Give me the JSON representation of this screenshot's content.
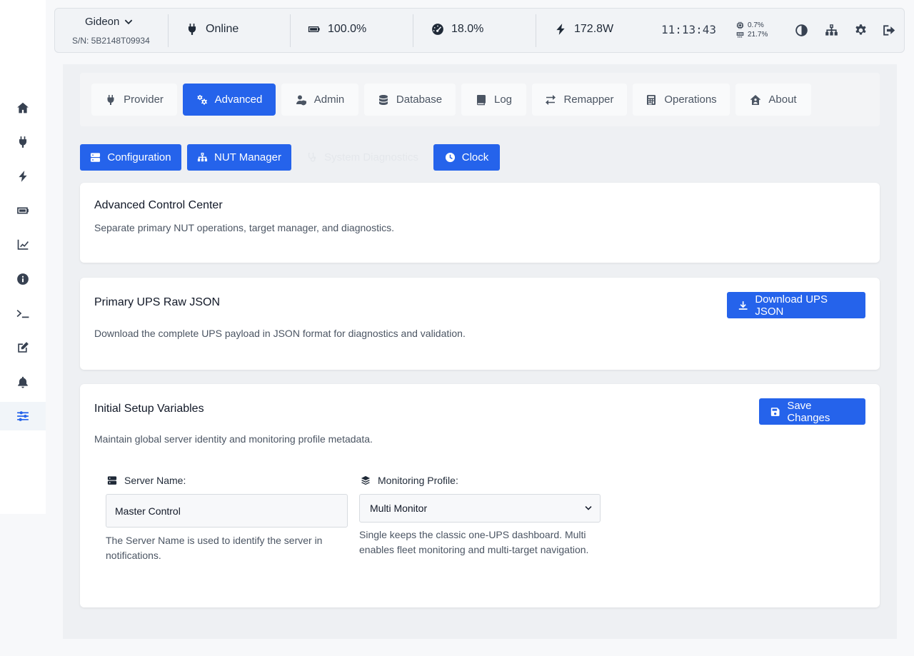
{
  "device": {
    "name": "Gideon",
    "serial": "S/N: 5B2148T09934"
  },
  "status": {
    "power": "Online",
    "battery": "100.0%",
    "load": "18.0%",
    "watts": "172.8W",
    "clock": "11:13:43",
    "cpu": "0.7%",
    "memory": "21.7%"
  },
  "sidebar": {
    "items": [
      {
        "icon": "home-icon"
      },
      {
        "icon": "plug-icon"
      },
      {
        "icon": "bolt-icon"
      },
      {
        "icon": "battery-icon"
      },
      {
        "icon": "chart-line-icon"
      },
      {
        "icon": "info-icon"
      },
      {
        "icon": "terminal-icon"
      },
      {
        "icon": "edit-icon"
      },
      {
        "icon": "bell-icon"
      },
      {
        "icon": "sliders-icon",
        "active": true
      }
    ]
  },
  "tabs": [
    {
      "label": "Provider"
    },
    {
      "label": "Advanced",
      "active": true
    },
    {
      "label": "Admin"
    },
    {
      "label": "Database"
    },
    {
      "label": "Log"
    },
    {
      "label": "Remapper"
    },
    {
      "label": "Operations"
    },
    {
      "label": "About"
    }
  ],
  "subtabs": [
    {
      "label": "Configuration"
    },
    {
      "label": "NUT Manager"
    },
    {
      "label": "System Diagnostics",
      "disabled": true
    },
    {
      "label": "Clock"
    }
  ],
  "cards": {
    "control": {
      "title": "Advanced Control Center",
      "desc": "Separate primary NUT operations, target manager, and diagnostics."
    },
    "raw_json": {
      "title": "Primary UPS Raw JSON",
      "desc": "Download the complete UPS payload in JSON format for diagnostics and validation.",
      "button": "Download UPS JSON"
    },
    "setup": {
      "title": "Initial Setup Variables",
      "desc": "Maintain global server identity and monitoring profile metadata.",
      "button": "Save Changes",
      "server_name_label": "Server Name:",
      "server_name_value": "Master Control",
      "server_name_help": "The Server Name is used to identify the server in notifications.",
      "profile_label": "Monitoring Profile:",
      "profile_value": "Multi Monitor",
      "profile_help": "Single keeps the classic one-UPS dashboard. Multi enables fleet monitoring and multi-target navigation."
    }
  },
  "colors": {
    "accent": "#2563eb",
    "background": "#eef0f3",
    "card": "#ffffff"
  }
}
